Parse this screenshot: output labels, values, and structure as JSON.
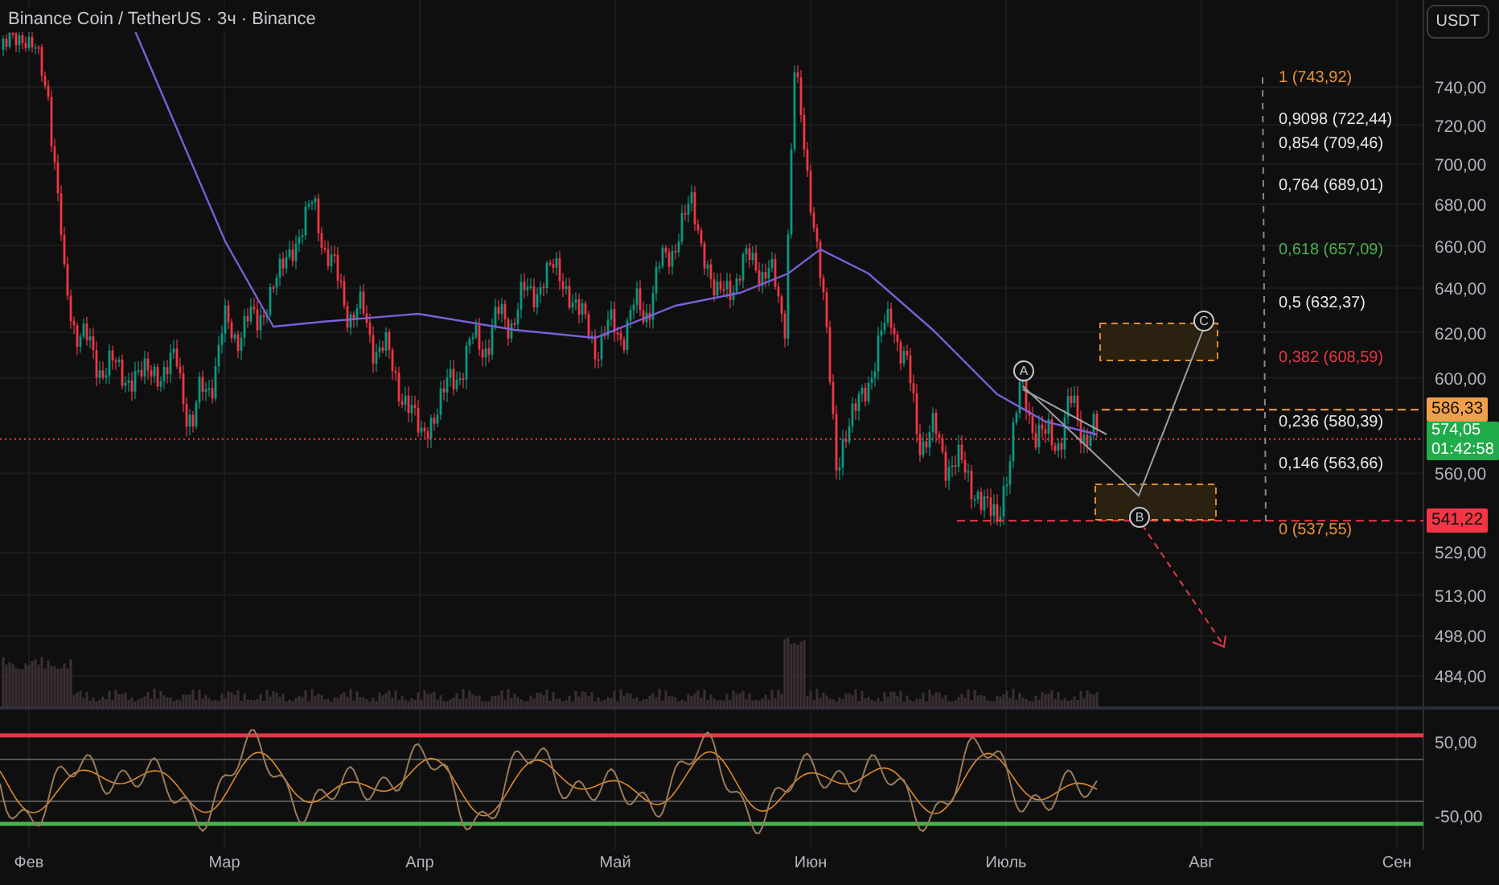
{
  "header": {
    "title": "Binance Coin / TetherUS · 3ч · Binance",
    "currency_button": "USDT"
  },
  "price_axis": [
    "740,00",
    "720,00",
    "700,00",
    "680,00",
    "660,00",
    "640,00",
    "620,00",
    "600,00",
    "560,00",
    "529,00",
    "513,00",
    "498,00",
    "484,00"
  ],
  "price_tags": [
    {
      "kind": "alert",
      "value": "586,33",
      "color": "#f0a04b"
    },
    {
      "kind": "last",
      "value": "574,05",
      "countdown": "01:42:58",
      "color": "#22ab4a"
    },
    {
      "kind": "alert",
      "value": "541,22",
      "color": "#f23645"
    }
  ],
  "fib_levels": [
    {
      "label": "1 (743,92)",
      "color": "#e8913a"
    },
    {
      "label": "0,9098 (722,44)",
      "color": "#e8e8e8"
    },
    {
      "label": "0,854 (709,46)",
      "color": "#e8e8e8"
    },
    {
      "label": "0,764 (689,01)",
      "color": "#e8e8e8"
    },
    {
      "label": "0,618 (657,09)",
      "color": "#4caf50"
    },
    {
      "label": "0,5 (632,37)",
      "color": "#e8e8e8"
    },
    {
      "label": "0,382 (608,59)",
      "color": "#e53945"
    },
    {
      "label": "0,236 (580,39)",
      "color": "#e8e8e8"
    },
    {
      "label": "0,146 (563,66)",
      "color": "#e8e8e8"
    },
    {
      "label": "0 (537,55)",
      "color": "#e8913a"
    }
  ],
  "wave_labels": [
    "A",
    "B",
    "C"
  ],
  "oscillator_axis": [
    "50,00",
    "-50,00"
  ],
  "time_axis": [
    "Фев",
    "Мар",
    "Апр",
    "Май",
    "Июн",
    "Июль",
    "Авг",
    "Сен"
  ]
}
